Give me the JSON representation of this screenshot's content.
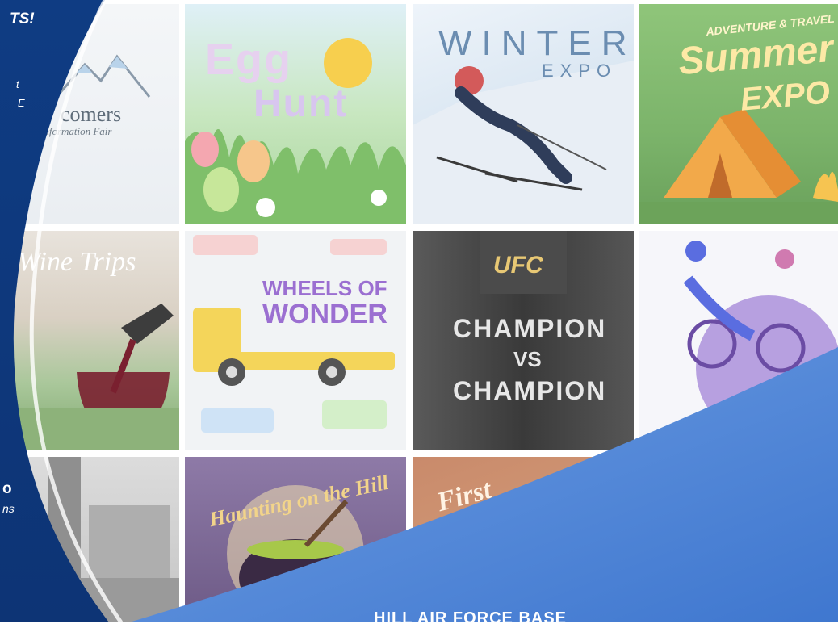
{
  "left_panel": {
    "headline_fragment": "TS!",
    "line1_fragment": "t",
    "line2_fragment": "E",
    "bottom_big_fragment": "o",
    "bottom_small_fragment": "ns"
  },
  "tiles": {
    "newcomers": {
      "title": "comers",
      "subtitle": "Information Fair"
    },
    "egg": {
      "line1": "Egg",
      "line2": "Hunt"
    },
    "winter": {
      "line1": "WINTER",
      "line2": "EXPO"
    },
    "summer": {
      "top": "ADVENTURE & TRAVEL",
      "line1": "Summer",
      "line2": "EXPO"
    },
    "wine": {
      "title": "Wine Trips"
    },
    "wheels": {
      "line1": "WHEELS OF",
      "line2": "WONDER"
    },
    "ufc": {
      "brand": "UFC",
      "line1": "CHAMPION",
      "line2": "VS",
      "line3": "CHAMPION"
    },
    "haunt": {
      "title": "Haunting on the Hill"
    },
    "first": {
      "title": "First"
    }
  },
  "footer": {
    "text": "HILL AIR FORCE BASE"
  },
  "colors": {
    "left_blue": "#0e3f86",
    "right_blue": "#4a82d6"
  }
}
